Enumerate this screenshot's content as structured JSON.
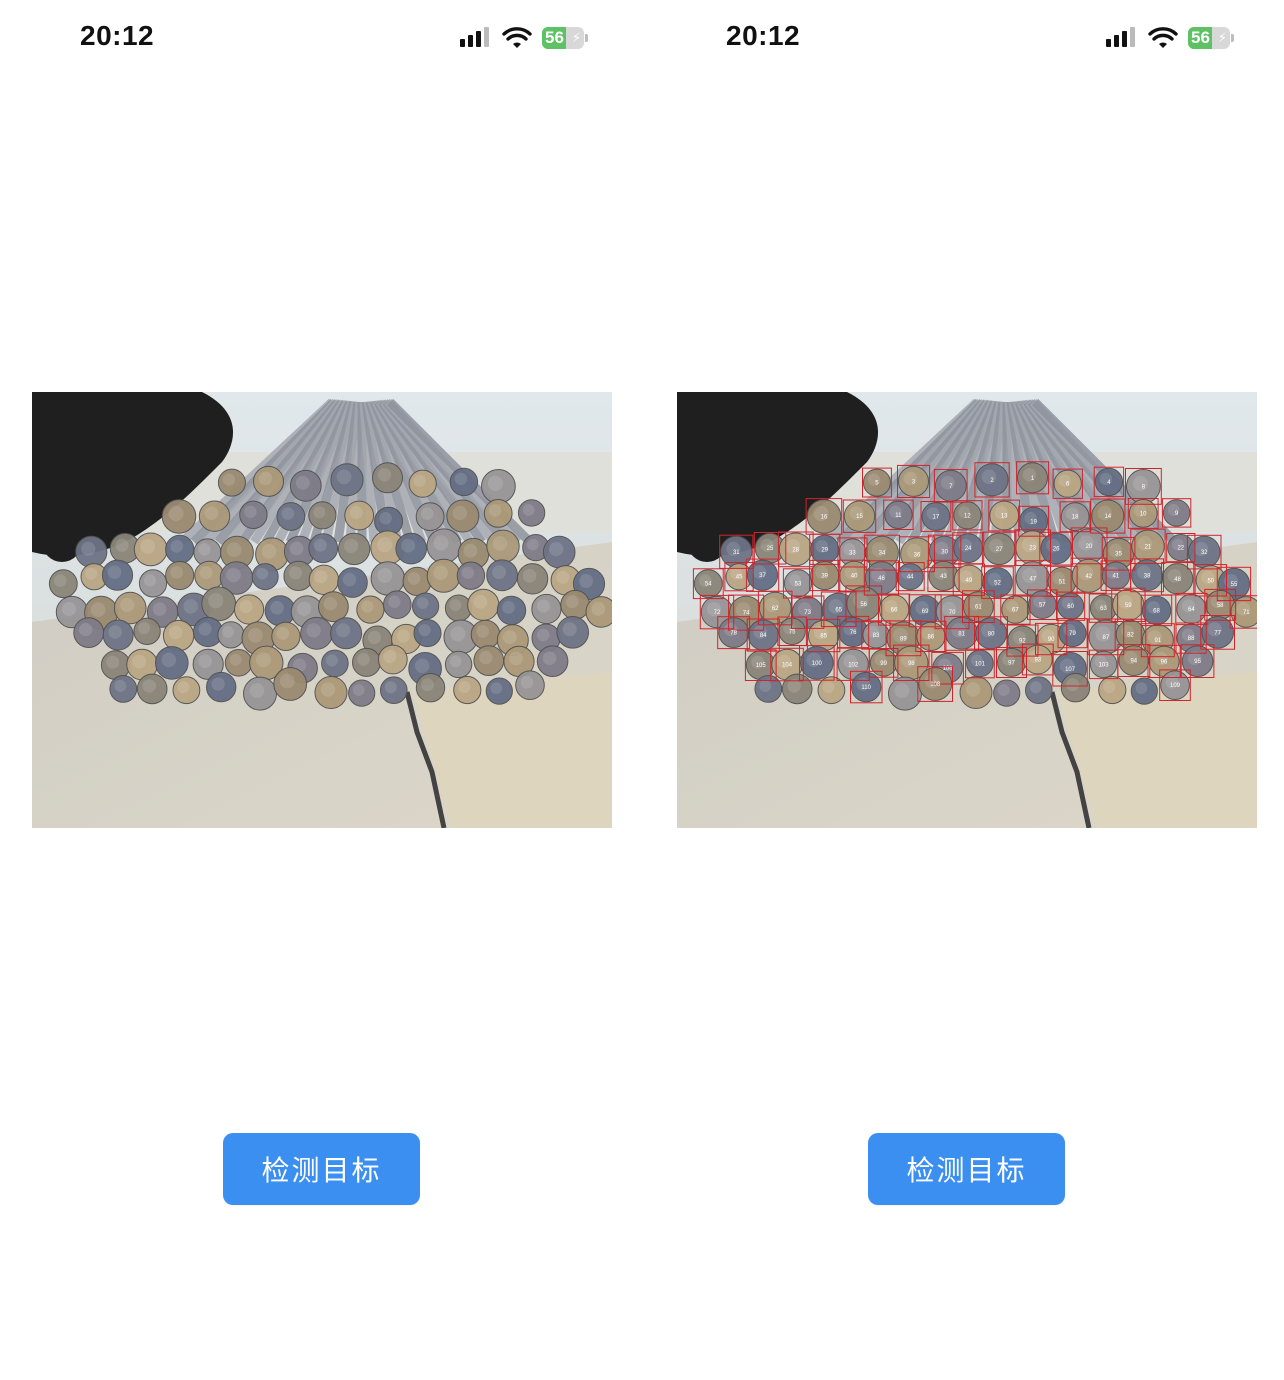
{
  "screens": [
    {
      "status": {
        "time": "20:12",
        "battery_percent": "56"
      },
      "detect_button": {
        "label": "检测目标"
      },
      "annotated": false
    },
    {
      "status": {
        "time": "20:12",
        "battery_percent": "56"
      },
      "detect_button": {
        "label": "检测目标"
      },
      "annotated": true
    }
  ],
  "colors": {
    "button": "#3b8ff0",
    "battery": "#5ec264",
    "box": "#d2232a"
  },
  "icons": [
    "signal-icon",
    "wifi-icon",
    "battery-icon",
    "charging-bolt-icon"
  ],
  "detections": {
    "labels": [
      "1",
      "2",
      "3",
      "4",
      "5",
      "6",
      "7",
      "8",
      "9",
      "10",
      "11",
      "12",
      "13",
      "14",
      "15",
      "16",
      "17",
      "18",
      "19",
      "20",
      "21",
      "22",
      "23",
      "24",
      "25",
      "26",
      "27",
      "28",
      "29",
      "30",
      "31",
      "32",
      "33",
      "34",
      "35",
      "36",
      "37",
      "38",
      "39",
      "40",
      "41",
      "42",
      "43",
      "44",
      "45",
      "46",
      "47",
      "48",
      "49",
      "50",
      "51",
      "52",
      "53",
      "54",
      "55",
      "56",
      "57",
      "58",
      "59",
      "60",
      "61",
      "62",
      "63",
      "64",
      "65",
      "66",
      "67",
      "68",
      "69",
      "70",
      "71",
      "72",
      "73",
      "74",
      "75",
      "76",
      "77",
      "78",
      "79",
      "80",
      "81",
      "82",
      "83",
      "84",
      "85",
      "86",
      "87",
      "88",
      "89",
      "90",
      "91",
      "92",
      "93",
      "94",
      "95",
      "96",
      "97",
      "98",
      "99",
      "100",
      "101",
      "102",
      "103",
      "104",
      "105",
      "106",
      "107",
      "108",
      "109",
      "110"
    ]
  }
}
